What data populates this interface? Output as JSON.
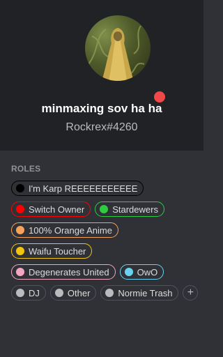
{
  "profile": {
    "username": "minmaxing sov ha ha",
    "tag": "Rockrex#4260",
    "status_color": "#f04747"
  },
  "roles_section": {
    "title": "ROLES",
    "roles": [
      {
        "name": "I'm Karp REEEEEEEEEEE",
        "color": "#000000"
      },
      {
        "name": "Switch Owner",
        "color": "#ff0000"
      },
      {
        "name": "Stardewers",
        "color": "#2ecc40"
      },
      {
        "name": "100% Orange Anime",
        "color": "#f7a25b"
      },
      {
        "name": "Waifu Toucher",
        "color": "#f1c40f"
      },
      {
        "name": "Degenerates United",
        "color": "#f4a6c0"
      },
      {
        "name": "OwO",
        "color": "#6ad2f0"
      },
      {
        "name": "DJ",
        "color": "#b9bbbe"
      },
      {
        "name": "Other",
        "color": "#b9bbbe"
      },
      {
        "name": "Normie Trash",
        "color": "#b9bbbe"
      }
    ],
    "add_icon": "plus-icon",
    "add_symbol": "+"
  }
}
